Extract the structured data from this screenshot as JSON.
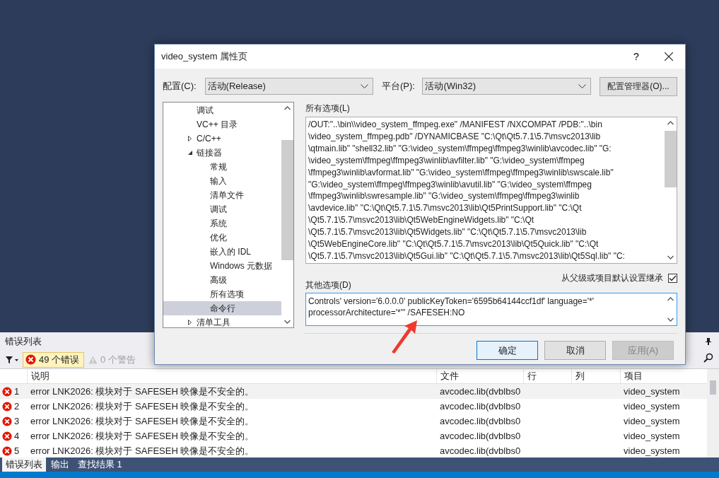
{
  "error_list": {
    "title": "错误列表",
    "filters": [
      {
        "kind": "error",
        "label": "49 个错误",
        "selected": true
      },
      {
        "kind": "warning",
        "label": "0 个警告",
        "selected": false
      }
    ],
    "columns": [
      "说明",
      "文件",
      "行",
      "列",
      "项目"
    ],
    "rows": [
      {
        "number": "1",
        "description": "error LNK2026: 模块对于 SAFESEH 映像是不安全的。",
        "file": "avcodec.lib(dvblbs0",
        "project": "video_system"
      },
      {
        "number": "2",
        "description": "error LNK2026: 模块对于 SAFESEH 映像是不安全的。",
        "file": "avcodec.lib(dvblbs0",
        "project": "video_system"
      },
      {
        "number": "3",
        "description": "error LNK2026: 模块对于 SAFESEH 映像是不安全的。",
        "file": "avcodec.lib(dvblbs0",
        "project": "video_system"
      },
      {
        "number": "4",
        "description": "error LNK2026: 模块对于 SAFESEH 映像是不安全的。",
        "file": "avcodec.lib(dvblbs0",
        "project": "video_system"
      },
      {
        "number": "5",
        "description": "error LNK2026: 模块对于 SAFESEH 映像是不安全的。",
        "file": "avcodec.lib(dvblbs0",
        "project": "video_system"
      }
    ]
  },
  "bottom_tabs": [
    {
      "label": "错误列表",
      "selected": true
    },
    {
      "label": "输出",
      "selected": false
    },
    {
      "label": "查找结果 1",
      "selected": false
    }
  ],
  "dialog": {
    "title": "video_system 属性页",
    "help": "?",
    "configuration": {
      "label": "配置(C):",
      "value": "活动(Release)"
    },
    "platform": {
      "label": "平台(P):",
      "value": "活动(Win32)"
    },
    "manager_button": "配置管理器(O)...",
    "tree": [
      {
        "label": "调试",
        "selected": false
      },
      {
        "label": "VC++ 目录",
        "selected": false
      },
      {
        "label": "C/C++",
        "selected": false,
        "expanded": false
      },
      {
        "label": "链接器",
        "selected": false,
        "expanded": true,
        "children": [
          {
            "label": "常规",
            "selected": false
          },
          {
            "label": "输入",
            "selected": false
          },
          {
            "label": "清单文件",
            "selected": false
          },
          {
            "label": "调试",
            "selected": false
          },
          {
            "label": "系统",
            "selected": false
          },
          {
            "label": "优化",
            "selected": false
          },
          {
            "label": "嵌入的 IDL",
            "selected": false
          },
          {
            "label": "Windows 元数据",
            "selected": false
          },
          {
            "label": "高级",
            "selected": false
          },
          {
            "label": "所有选项",
            "selected": false
          },
          {
            "label": "命令行",
            "selected": true
          }
        ]
      },
      {
        "label": "清单工具",
        "selected": false,
        "expanded": false
      }
    ],
    "all_options": {
      "label": "所有选项(L)",
      "value_lines": [
        "/OUT:\"..\\bin\\\\video_system_ffmpeg.exe\" /MANIFEST /NXCOMPAT /PDB:\"..\\bin",
        "\\video_system_ffmpeg.pdb\" /DYNAMICBASE \"C:\\Qt\\Qt5.7.1\\5.7\\msvc2013\\lib",
        "\\qtmain.lib\" \"shell32.lib\" \"G:\\video_system\\ffmpeg\\ffmpeg3\\winlib\\avcodec.lib\" \"G:",
        "\\video_system\\ffmpeg\\ffmpeg3\\winlib\\avfilter.lib\" \"G:\\video_system\\ffmpeg",
        "\\ffmpeg3\\winlib\\avformat.lib\" \"G:\\video_system\\ffmpeg\\ffmpeg3\\winlib\\swscale.lib\"",
        "\"G:\\video_system\\ffmpeg\\ffmpeg3\\winlib\\avutil.lib\" \"G:\\video_system\\ffmpeg",
        "\\ffmpeg3\\winlib\\swresample.lib\" \"G:\\video_system\\ffmpeg\\ffmpeg3\\winlib",
        "\\avdevice.lib\" \"C:\\Qt\\Qt5.7.1\\5.7\\msvc2013\\lib\\Qt5PrintSupport.lib\" \"C:\\Qt",
        "\\Qt5.7.1\\5.7\\msvc2013\\lib\\Qt5WebEngineWidgets.lib\" \"C:\\Qt",
        "\\Qt5.7.1\\5.7\\msvc2013\\lib\\Qt5Widgets.lib\" \"C:\\Qt\\Qt5.7.1\\5.7\\msvc2013\\lib",
        "\\Qt5WebEngineCore.lib\" \"C:\\Qt\\Qt5.7.1\\5.7\\msvc2013\\lib\\Qt5Quick.lib\" \"C:\\Qt",
        "\\Qt5.7.1\\5.7\\msvc2013\\lib\\Qt5Gui.lib\" \"C:\\Qt\\Qt5.7.1\\5.7\\msvc2013\\lib\\Qt5Sql.lib\" \"C:"
      ]
    },
    "inherit": {
      "label": "从父级或项目默认设置继承",
      "checked": true
    },
    "other_options": {
      "label": "其他选项(D)",
      "value_lines": [
        "Controls' version='6.0.0.0' publicKeyToken='6595b64144ccf1df' language='*'",
        "processorArchitecture='*'\" /SAFESEH:NO"
      ]
    },
    "buttons": [
      {
        "label": "确定",
        "kind": "default",
        "disabled": false
      },
      {
        "label": "取消",
        "kind": "normal",
        "disabled": false
      },
      {
        "label": "应用(A)",
        "kind": "normal",
        "disabled": true
      }
    ]
  }
}
